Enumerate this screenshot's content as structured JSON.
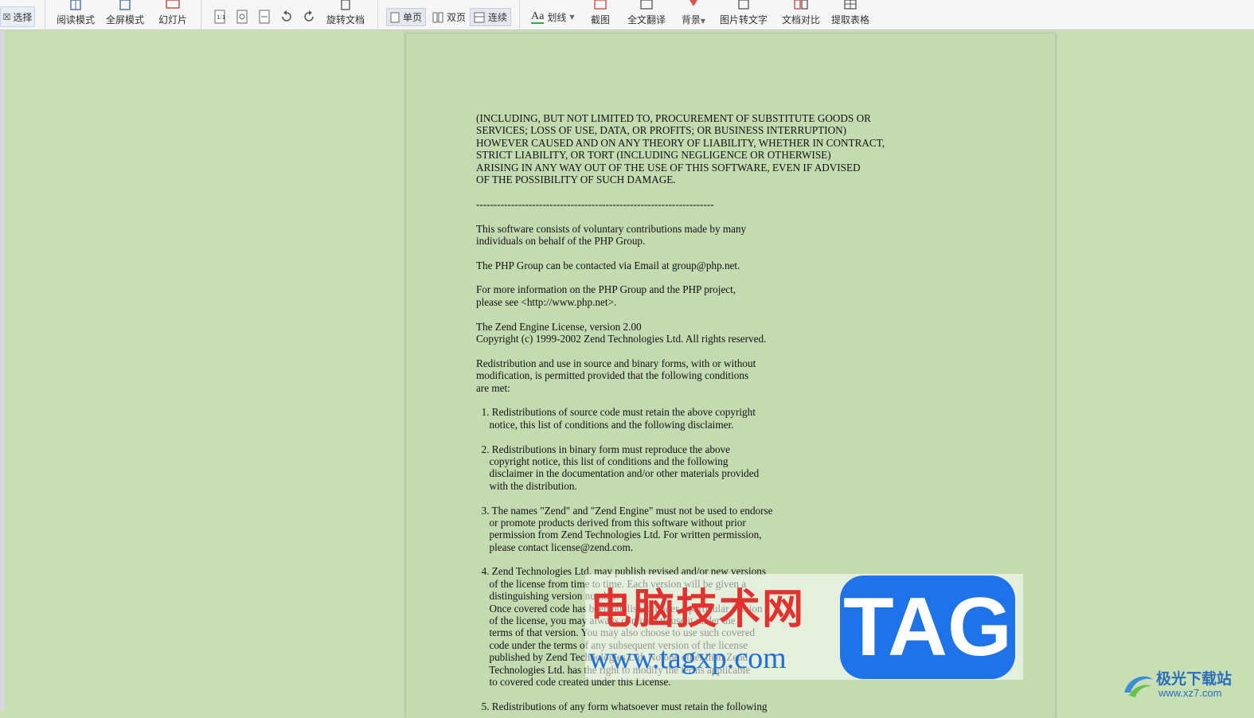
{
  "toolbar": {
    "select_label": "选择",
    "read_mode": "阅读模式",
    "fullscreen": "全屏模式",
    "slideshow": "幻灯片",
    "rotate_doc": "旋转文档",
    "single_page": "单页",
    "double_page": "双页",
    "continuous": "连续",
    "underline": "划线",
    "screenshot": "截图",
    "translate": "全文翻译",
    "background": "背景",
    "img_to_text": "图片转文字",
    "compare": "文档对比",
    "extract_table": "提取表格"
  },
  "document": {
    "lines": [
      "(INCLUDING, BUT NOT LIMITED TO, PROCUREMENT OF SUBSTITUTE GOODS OR",
      "SERVICES; LOSS OF USE, DATA, OR PROFITS; OR BUSINESS INTERRUPTION)",
      "HOWEVER CAUSED AND ON ANY THEORY OF LIABILITY, WHETHER IN CONTRACT,",
      "STRICT LIABILITY, OR TORT (INCLUDING NEGLIGENCE OR OTHERWISE)",
      "ARISING IN ANY WAY OUT OF THE USE OF THIS SOFTWARE, EVEN IF ADVISED",
      "OF THE POSSIBILITY OF SUCH DAMAGE.",
      "",
      "--------------------------------------------------------------------",
      "",
      "This software consists of voluntary contributions made by many",
      "individuals on behalf of the PHP Group.",
      "",
      "The PHP Group can be contacted via Email at group@php.net.",
      "",
      "For more information on the PHP Group and the PHP project,",
      "please see <http://www.php.net>.",
      "",
      "The Zend Engine License, version 2.00",
      "Copyright (c) 1999-2002 Zend Technologies Ltd. All rights reserved.",
      "",
      "Redistribution and use in source and binary forms, with or without",
      "modification, is permitted provided that the following conditions",
      "are met:",
      "",
      "  1. Redistributions of source code must retain the above copyright",
      "     notice, this list of conditions and the following disclaimer.",
      "",
      "  2. Redistributions in binary form must reproduce the above",
      "     copyright notice, this list of conditions and the following",
      "     disclaimer in the documentation and/or other materials provided",
      "     with the distribution.",
      "",
      "  3. The names \"Zend\" and \"Zend Engine\" must not be used to endorse",
      "     or promote products derived from this software without prior",
      "     permission from Zend Technologies Ltd. For written permission,",
      "     please contact license@zend.com.",
      "",
      "  4. Zend Technologies Ltd. may publish revised and/or new versions",
      "     of the license from time to time. Each version will be given a",
      "     distinguishing version number.",
      "     Once covered code has been published under a particular version",
      "     of the license, you may always continue to use it under the",
      "     terms of that version. You may also choose to use such covered",
      "     code under the terms of any subsequent version of the license",
      "     published by Zend Technologies Ltd. No one other than Zend",
      "     Technologies Ltd. has the right to modify the terms applicable",
      "     to covered code created under this License.",
      "",
      "  5. Redistributions of any form whatsoever must retain the following"
    ]
  },
  "watermark": {
    "cn_text": "电脑技术网",
    "url": "www.tagxp.com",
    "tag": "TAG",
    "corner_cn": "极光下载站",
    "corner_url": "www.xz7.com"
  }
}
